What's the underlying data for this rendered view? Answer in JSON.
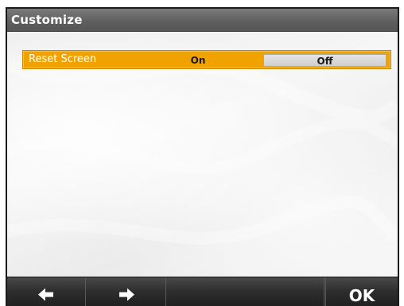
{
  "window": {
    "title": "Customize"
  },
  "setting": {
    "label": "Reset Screen",
    "options": [
      "On",
      "Off"
    ],
    "selected": "On",
    "highlight_color": "#f0a300"
  },
  "footer": {
    "left_icon": "arrow-left-icon",
    "right_icon": "arrow-right-icon",
    "ok_label": "OK"
  }
}
